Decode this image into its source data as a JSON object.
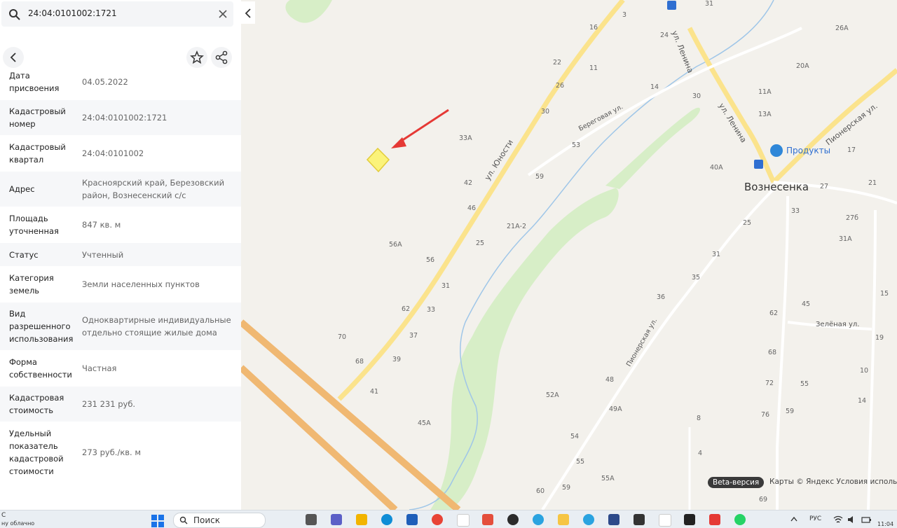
{
  "search": {
    "value": "24:04:0101002:1721"
  },
  "panel": {
    "rows": [
      {
        "label": "Дата присвоения",
        "value": "04.05.2022"
      },
      {
        "label": "Кадастровый номер",
        "value": "24:04:0101002:1721"
      },
      {
        "label": "Кадастровый квартал",
        "value": "24:04:0101002"
      },
      {
        "label": "Адрес",
        "value": "Красноярский край, Березовский район, Вознесенский с/с"
      },
      {
        "label": "Площадь уточненная",
        "value": "847 кв. м"
      },
      {
        "label": "Статус",
        "value": "Учтенный"
      },
      {
        "label": "Категория земель",
        "value": "Земли населенных пунктов"
      },
      {
        "label": "Вид разрешенного использования",
        "value": "Одноквартирные индивидуальные отдельно стоящие жилые дома"
      },
      {
        "label": "Форма собственности",
        "value": "Частная"
      },
      {
        "label": "Кадастровая стоимость",
        "value": "231 231 руб."
      },
      {
        "label": "Удельный показатель кадастровой стоимости",
        "value": "273 руб./кв. м"
      }
    ]
  },
  "map": {
    "village": "Вознесенка",
    "poi": "Продукты",
    "streets": [
      "ул. Юности",
      "Береговая ул.",
      "ул. Ленина",
      "Пионерская ул.",
      "Зелёная ул."
    ],
    "house_numbers": [
      "3",
      "16",
      "11",
      "22",
      "26",
      "30",
      "53",
      "59",
      "33А",
      "42",
      "46",
      "21А-2",
      "25",
      "56А",
      "56",
      "31",
      "62",
      "33",
      "37",
      "70",
      "68",
      "39",
      "41",
      "45А",
      "52А",
      "49А",
      "48",
      "54",
      "55",
      "55А",
      "59",
      "60",
      "8",
      "4",
      "36",
      "35",
      "31",
      "25",
      "40А",
      "33",
      "62",
      "68",
      "72",
      "76",
      "45",
      "55",
      "59",
      "13А",
      "11А",
      "20А",
      "26А",
      "27",
      "21",
      "17",
      "27б",
      "31А",
      "15",
      "19",
      "10",
      "14",
      "14",
      "24",
      "30",
      "31",
      "69"
    ],
    "beta_label": "Beta-версия",
    "copyright": "Карты © Яндекс   Условия использования"
  },
  "taskbar": {
    "search_label": "Поиск",
    "lang": "РУС",
    "time": "11:04",
    "left_text": "С",
    "left_subtext": "ну облачно"
  }
}
